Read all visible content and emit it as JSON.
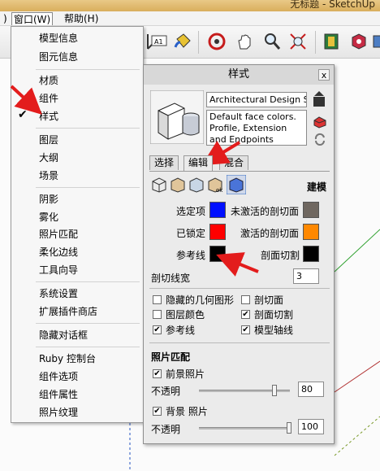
{
  "window": {
    "title_fragment": "无标题 - SketchUp"
  },
  "menubar": {
    "partial": ")",
    "window_menu": "窗口(W)",
    "help_menu": "帮助(H)"
  },
  "window_menu": {
    "items": [
      "模型信息",
      "图元信息",
      "材质",
      "组件",
      "样式",
      "图层",
      "大纲",
      "场景",
      "阴影",
      "雾化",
      "照片匹配",
      "柔化边线",
      "工具向导",
      "系统设置",
      "扩展插件商店",
      "隐藏对话框",
      "Ruby 控制台",
      "组件选项",
      "组件属性",
      "照片纹理"
    ],
    "checked": "✔"
  },
  "styles_panel": {
    "title": "样式",
    "close": "x",
    "style_name": "Architectural Design Style",
    "description": "Default face colors. Profile, Extension and Endpoints edges. Light",
    "tabs": [
      "选择",
      "编辑",
      "混合"
    ],
    "edit_section_label": "建模",
    "colors": {
      "selected_label": "选定项",
      "selected_color": "#0010ff",
      "locked_label": "已锁定",
      "locked_color": "#ff0000",
      "guides_label": "参考线",
      "guides_color": "#000000",
      "inactive_section_label": "未激活的剖切面",
      "inactive_section_color": "#6f6760",
      "active_section_label": "激活的剖切面",
      "active_section_color": "#ff8800",
      "section_cuts_label": "剖面切割",
      "section_cuts_color": "#000000"
    },
    "section_line_width": {
      "label": "剖切线宽",
      "value": "3"
    },
    "toggles": {
      "hidden_geometry": {
        "label": "隐藏的几何图形",
        "checked": false
      },
      "section_planes": {
        "label": "剖切面",
        "checked": false
      },
      "layer_colors": {
        "label": "图层颜色",
        "checked": false
      },
      "section_cuts": {
        "label": "剖面切割",
        "checked": true
      },
      "guides": {
        "label": "参考线",
        "checked": true
      },
      "model_axes": {
        "label": "模型轴线",
        "checked": true
      }
    },
    "photo_match": {
      "heading": "照片匹配",
      "foreground": {
        "label": "前景照片",
        "checked": true,
        "opacity_label": "不透明",
        "opacity": "80",
        "opacity_fraction": 0.8
      },
      "background": {
        "label": "背景 照片",
        "checked": true,
        "opacity_label": "不透明",
        "opacity": "100",
        "opacity_fraction": 1.0
      }
    }
  }
}
